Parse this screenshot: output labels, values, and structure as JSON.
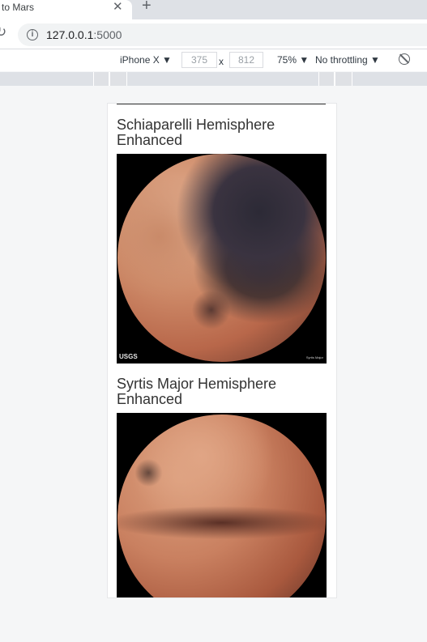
{
  "browser": {
    "tab_title": "to Mars",
    "url_host": "127.0.0.1",
    "url_port": ":5000"
  },
  "device_toolbar": {
    "device": "iPhone X ▼",
    "width": "375",
    "separator": "x",
    "height": "812",
    "zoom": "75% ▼",
    "throttling": "No throttling ▼"
  },
  "hemispheres": [
    {
      "title": "Schiaparelli Hemisphere Enhanced",
      "logo": "USGS",
      "caption": "Syrtis Major"
    },
    {
      "title": "Syrtis Major Hemisphere Enhanced"
    }
  ],
  "colors": {
    "mars_light": "#d99a74",
    "mars_mid": "#b8674a",
    "mars_dark": "#5a3a33",
    "mars_shadow": "#2c2a36"
  }
}
